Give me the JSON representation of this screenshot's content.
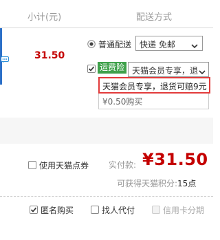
{
  "header": {
    "subtotal_label": "小计(元)",
    "shipping_label": "配送方式"
  },
  "item": {
    "price": "31.50",
    "shipping_option_label": "普通配送",
    "shipping_select_value": "快递 免邮",
    "insurance_badge": "运费险",
    "insurance_select_value": "天猫会员专享，退",
    "dropdown_options": [
      "天猫会员专享，退货可赔9元",
      "¥0.50购买"
    ]
  },
  "summary": {
    "points_label": "使用天猫点券",
    "pay_label": "实付款:",
    "pay_amount": "¥31.50",
    "earn_label": "可获得天猫积分:",
    "earn_value": "15点"
  },
  "options": {
    "anonymous_label": "匿名购买",
    "proxy_label": "找人代付",
    "credit_label": "信用卡分期"
  },
  "colors": {
    "price_red": "#c40000",
    "badge_green": "#3fa14b",
    "highlight_red": "#e23a3a"
  }
}
